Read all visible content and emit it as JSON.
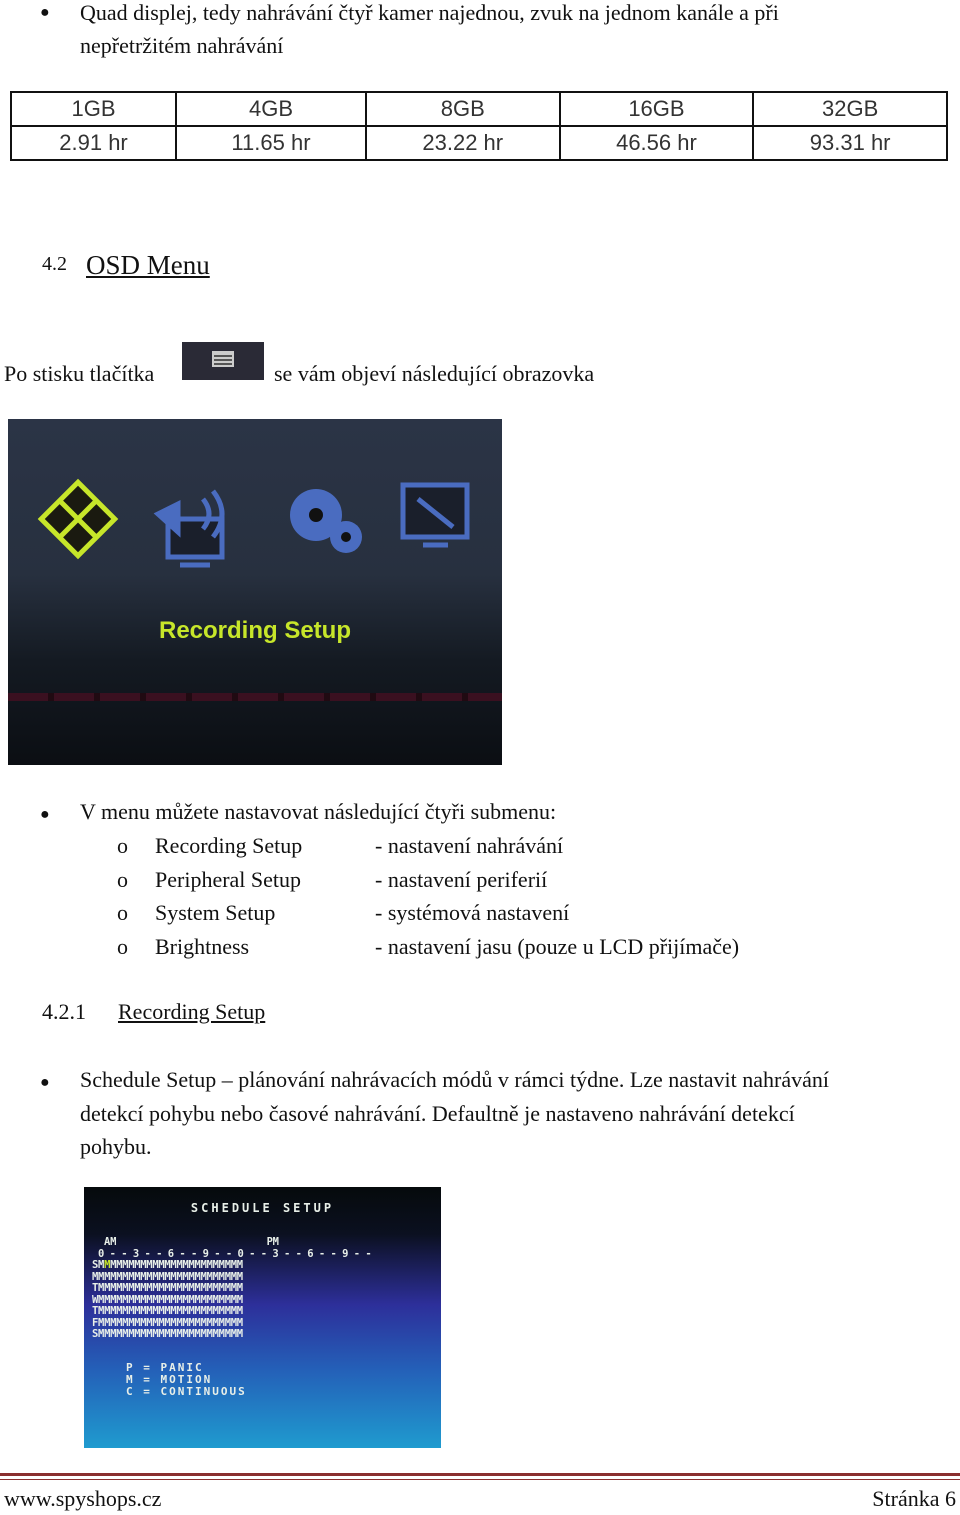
{
  "intro_bullet": [
    "Quad displej, tedy nahrávání čtyř kamer najednou, zvuk na jednom kanále a při",
    "nepřetržitém nahrávání"
  ],
  "capacity_table": {
    "headers": [
      "1GB",
      "4GB",
      "8GB",
      "16GB",
      "32GB"
    ],
    "values": [
      "2.91 hr",
      "11.65 hr",
      "23.22 hr",
      "46.56 hr",
      "93.31 hr"
    ]
  },
  "section": {
    "number": "4.2",
    "title": "OSD Menu"
  },
  "press_text": {
    "before": "Po stisku tlačítka",
    "after": "se vám objeví následující obrazovka",
    "button_icon": "menu-icon"
  },
  "osd_screen": {
    "icons": [
      "film-icon",
      "speaker-monitor-icon",
      "gears-icon",
      "wrench-monitor-icon"
    ],
    "selected_label": "Recording Setup",
    "accent": "#c7e62a"
  },
  "submenu_intro": "V menu můžete nastavovat následující čtyři submenu:",
  "submenus": [
    {
      "name": "Recording Setup",
      "desc": "- nastavení nahrávání"
    },
    {
      "name": "Peripheral Setup",
      "desc": "- nastavení periferií"
    },
    {
      "name": "System Setup",
      "desc": "- systémová nastavení"
    },
    {
      "name": "Brightness",
      "desc": "- nastavení jasu (pouze u LCD přijímače)"
    }
  ],
  "subsection": {
    "number": "4.2.1",
    "title": "Recording Setup"
  },
  "schedule_bullet": [
    "Schedule Setup – plánování nahrávacích módů v rámci týdne. Lze nastavit nahrávání",
    "detekcí pohybu nebo časové nahrávání. Defaultně je nastaveno nahrávání detekcí",
    "pohybu."
  ],
  "schedule_screen": {
    "title": "SCHEDULE SETUP",
    "am": "AM",
    "pm": "PM",
    "hour_ruler": "0--3--6--9--0--3--6--9--",
    "days": [
      "S",
      "M",
      "T",
      "W",
      "T",
      "F",
      "S"
    ],
    "cell_value": "M",
    "hours": 24,
    "legend": [
      "P = PANIC",
      "M = MOTION",
      "C = CONTINUOUS"
    ]
  },
  "footer": {
    "site": "www.spyshops.cz",
    "page": "Stránka 6"
  }
}
